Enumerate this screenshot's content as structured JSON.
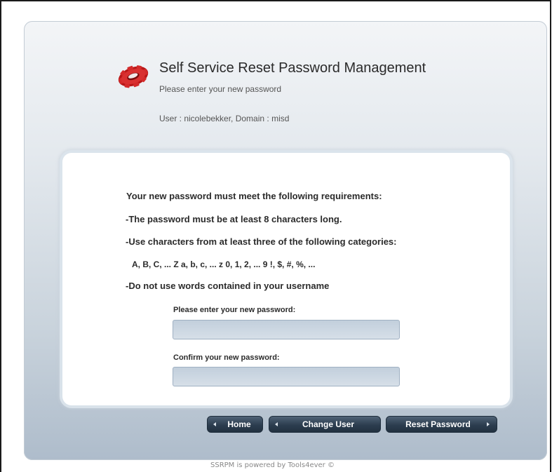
{
  "header": {
    "title": "Self Service Reset Password Management",
    "subtitle": "Please enter your new password",
    "user_info": "User : nicolebekker, Domain : misd",
    "logo_icon": "red-gear-logo-icon",
    "logo_color": "#cc2222"
  },
  "requirements": {
    "heading": "Your new password must meet the following requirements:",
    "min_length": "-The password must be at least 8 characters long.",
    "categories_intro": "-Use characters from at least three of the following categories:",
    "categories": "A, B, C, ... Z a, b, c, ... z 0, 1, 2, ... 9 !, $, #, %, ...",
    "no_username": "-Do not use words contained in your username"
  },
  "form": {
    "new_password_label": "Please enter your new password:",
    "new_password_value": "",
    "confirm_password_label": "Confirm your new password:",
    "confirm_password_value": ""
  },
  "buttons": {
    "home": "Home",
    "change_user": "Change User",
    "reset_password": "Reset Password"
  },
  "footer": {
    "text": "SSRPM is powered by Tools4ever ©"
  },
  "colors": {
    "button_bg": "#2c3d4f",
    "panel_bg": "#c9d3dc"
  }
}
